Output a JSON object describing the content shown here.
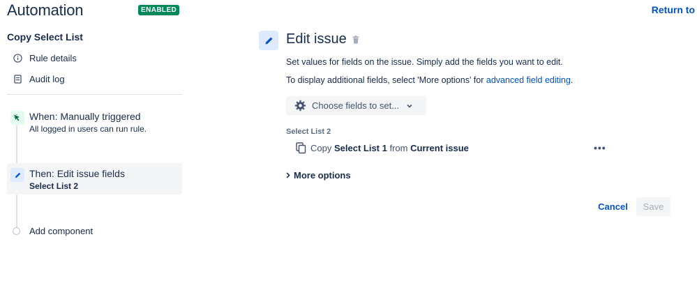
{
  "header": {
    "title": "Automation",
    "status": "ENABLED",
    "return_link": "Return to"
  },
  "sidebar": {
    "rule_name": "Copy Select List",
    "nav": [
      {
        "label": "Rule details",
        "icon": "info-icon"
      },
      {
        "label": "Audit log",
        "icon": "document-icon"
      }
    ],
    "components": [
      {
        "title": "When: Manually triggered",
        "subtitle": "All logged in users can run rule.",
        "icon": "cursor-click-icon"
      },
      {
        "title": "Then: Edit issue fields",
        "subtitle": "Select List 2",
        "icon": "pencil-icon"
      }
    ],
    "add_component": "Add component"
  },
  "panel": {
    "title": "Edit issue",
    "description": "Set values for fields on the issue. Simply add the fields you want to edit.",
    "additional_prefix": "To display additional fields, select 'More options' for ",
    "additional_link": "advanced field editing",
    "additional_suffix": ".",
    "choose_fields": "Choose fields to set...",
    "field_label": "Select List 2",
    "copy": {
      "prefix": "Copy ",
      "source_field": "Select List 1",
      "middle": " from ",
      "source_issue": "Current issue"
    },
    "more_menu": "•••",
    "more_options": "More options",
    "cancel": "Cancel",
    "save": "Save"
  },
  "colors": {
    "enabled": "#00875a",
    "link": "#0052cc",
    "trigger_bg": "#e3fcef",
    "action_bg": "#deebff"
  }
}
